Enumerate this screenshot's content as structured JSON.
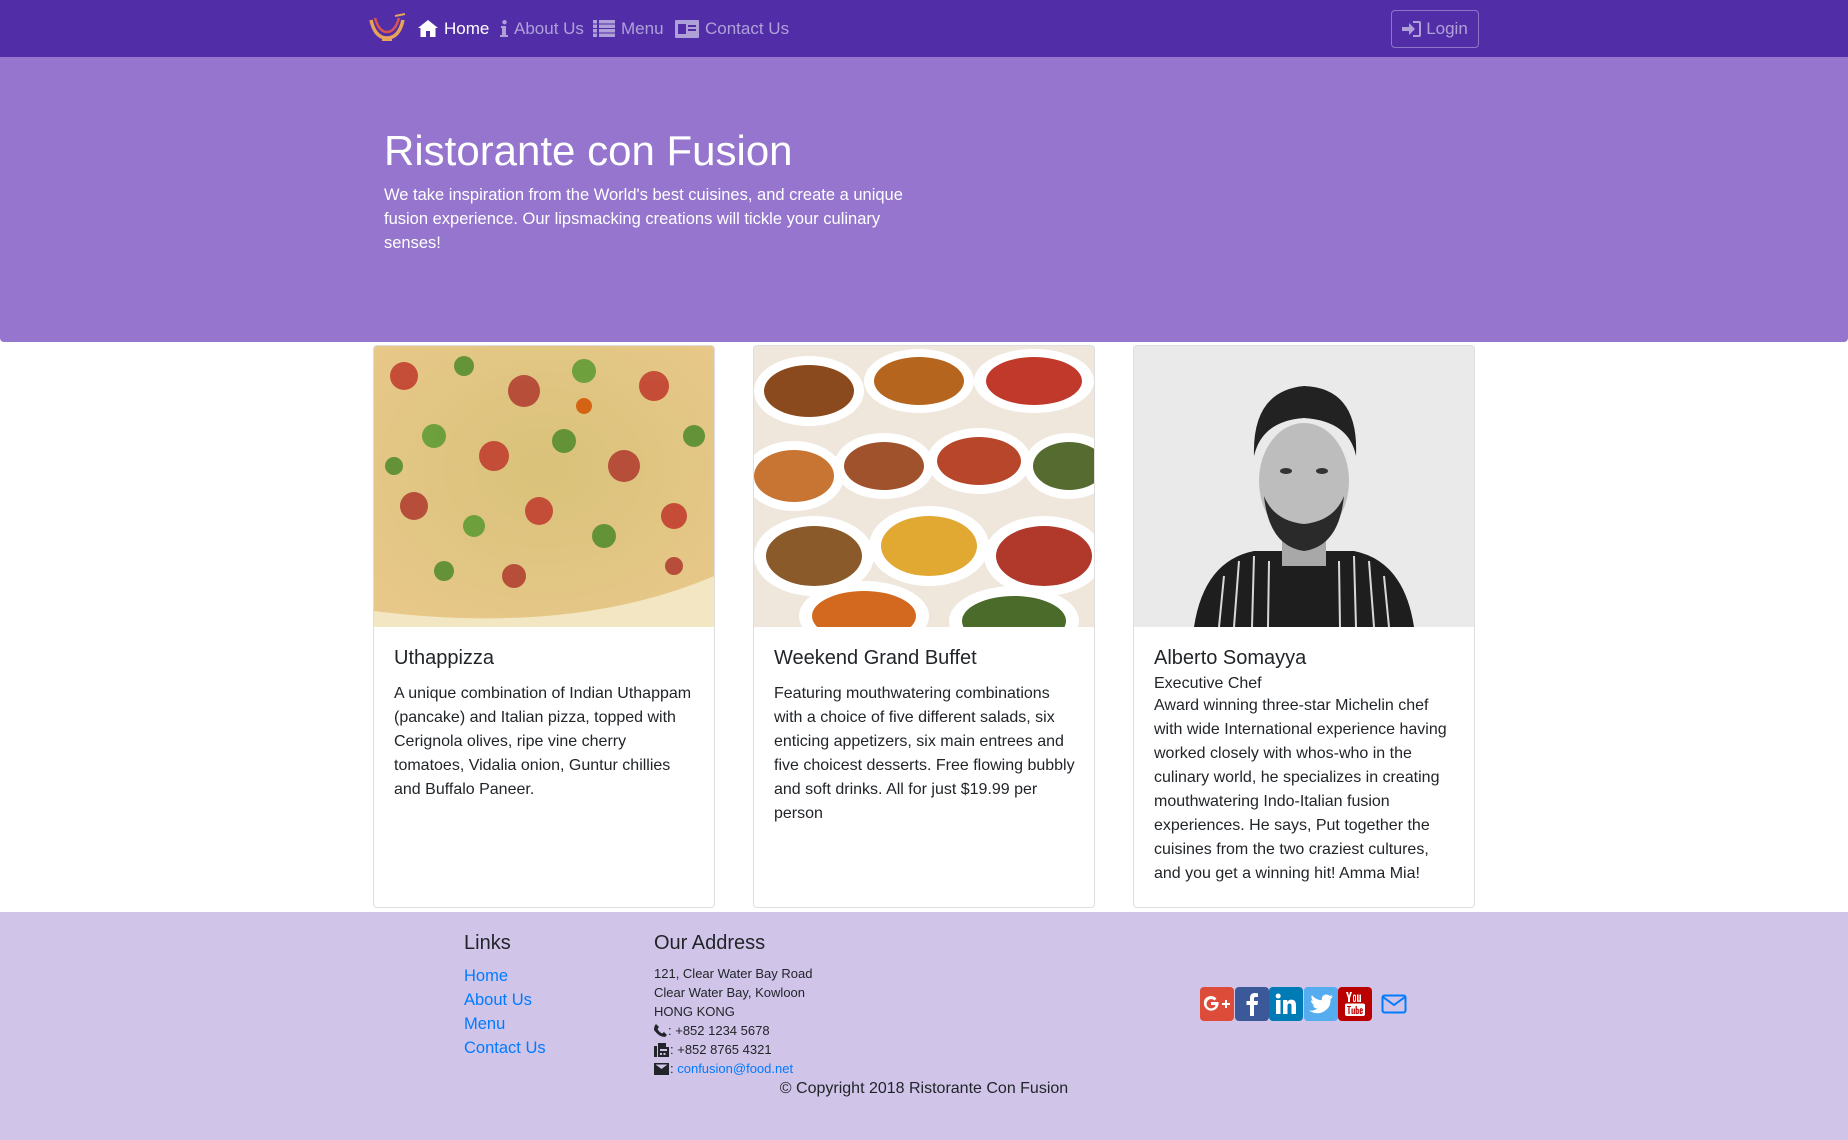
{
  "nav": {
    "items": [
      {
        "label": "Home",
        "icon": "home-icon"
      },
      {
        "label": "About Us",
        "icon": "info-icon"
      },
      {
        "label": "Menu",
        "icon": "list-icon"
      },
      {
        "label": "Contact Us",
        "icon": "address-card-icon"
      }
    ],
    "login_label": "Login"
  },
  "hero": {
    "title": "Ristorante con Fusion",
    "text": "We take inspiration from the World's best cuisines, and create a unique fusion experience. Our lipsmacking creations will tickle your culinary senses!"
  },
  "cards": [
    {
      "title": "Uthappizza",
      "text": "A unique combination of Indian Uthappam (pancake) and Italian pizza, topped with Cerignola olives, ripe vine cherry tomatoes, Vidalia onion, Guntur chillies and Buffalo Paneer.",
      "image": "pizza-photo"
    },
    {
      "title": "Weekend Grand Buffet",
      "text": "Featuring mouthwatering combinations with a choice of five different salads, six enticing appetizers, six main entrees and five choicest desserts. Free flowing bubbly and soft drinks. All for just $19.99 per person",
      "image": "buffet-photo"
    },
    {
      "title": "Alberto Somayya",
      "subtitle": "Executive Chef",
      "text": "Award winning three-star Michelin chef with wide International experience having worked closely with whos-who in the culinary world, he specializes in creating mouthwatering Indo-Italian fusion experiences. He says, Put together the cuisines from the two craziest cultures, and you get a winning hit! Amma Mia!",
      "image": "chef-portrait-photo"
    }
  ],
  "footer": {
    "links_heading": "Links",
    "links": [
      "Home",
      "About Us",
      "Menu",
      "Contact Us"
    ],
    "address_heading": "Our Address",
    "address_lines": [
      "121, Clear Water Bay Road",
      "Clear Water Bay, Kowloon",
      "HONG KONG"
    ],
    "phone": ": +852 1234 5678",
    "fax": ": +852 8765 4321",
    "email_prefix": ": ",
    "email": "confusion@food.net",
    "copyright": "© Copyright 2018 Ristorante Con Fusion"
  },
  "colors": {
    "navbar": "#512DA8",
    "jumbotron": "#9575CD",
    "footer": "#D1C4E9",
    "link": "#007bff"
  }
}
